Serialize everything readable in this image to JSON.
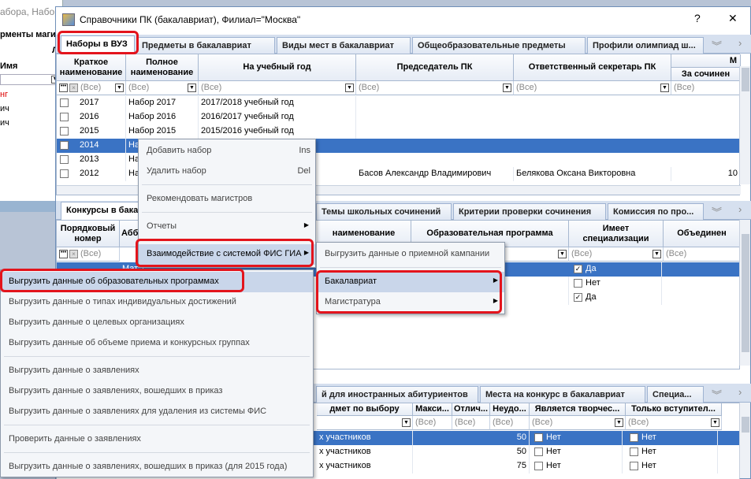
{
  "bg_window": {
    "title": "абора, Набор",
    "header": "рменты магис",
    "col_letter": "Л",
    "name_col": "Имя",
    "rows": [
      "нг",
      "ич",
      "ич"
    ]
  },
  "window": {
    "title": "Справочники ПК (бакалавриат), Филиал=\"Москва\"",
    "help": "?",
    "close": "✕"
  },
  "top_tabs": [
    "Наборы в ВУЗ",
    "Предметы в бакалавриат",
    "Виды мест в бакалавриат",
    "Общеобразовательные предметы",
    "Профили олимпиад ш..."
  ],
  "grid1": {
    "headers": [
      "Краткое наименование",
      "Полное наименование",
      "На учебный год",
      "Председатель ПК",
      "Ответственный секретарь ПК",
      "За сочинен"
    ],
    "group_header": "М",
    "filter_all": "(Все)",
    "rows": [
      {
        "short": "2017",
        "full": "Набор 2017",
        "year": "2017/2018 учебный год",
        "chair": "",
        "secretary": "",
        "extra": ""
      },
      {
        "short": "2016",
        "full": "Набор 2016",
        "year": "2016/2017 учебный год",
        "chair": "",
        "secretary": "",
        "extra": ""
      },
      {
        "short": "2015",
        "full": "Набор 2015",
        "year": "2015/2016 учебный год",
        "chair": "",
        "secretary": "",
        "extra": ""
      },
      {
        "short": "2014",
        "full": "На",
        "year": "",
        "chair": "",
        "secretary": "",
        "extra": ""
      },
      {
        "short": "2013",
        "full": "На",
        "year": "",
        "chair": "",
        "secretary": "",
        "extra": ""
      },
      {
        "short": "2012",
        "full": "На",
        "year": "",
        "chair": "Басов Александр Владимирович",
        "secretary": "Белякова Оксана Викторовна",
        "extra": "10"
      }
    ]
  },
  "mid_tabs": [
    "Конкурсы в бака",
    "Темы школьных сочинений",
    "Критерии проверки сочинения",
    "Комиссия по про..."
  ],
  "grid2": {
    "headers": [
      "Порядковый номер",
      "Абб",
      "наименование",
      "Образовательная программа",
      "Имеет специализации",
      "Объединен"
    ],
    "filter_all": "(Все)",
    "rows": [
      {
        "c1": "",
        "abbr": "Мат",
        "prog": "",
        "spec": "Да",
        "checked": true
      },
      {
        "c1": "",
        "abbr": "",
        "prog": "ность",
        "spec": "Нет",
        "checked": false
      },
      {
        "c1": "",
        "abbr": "",
        "prog": "ет)",
        "spec": "Да",
        "checked": true
      }
    ]
  },
  "bottom_tabs": [
    "й для иностранных абитуриентов",
    "Места на конкурс в бакалавриат",
    "Специа..."
  ],
  "grid3": {
    "headers": [
      "дмет по выбору",
      "Макси...",
      "Отлич...",
      "Неудо...",
      "Является творчес...",
      "Только вступител..."
    ],
    "filter_all": "(Все)",
    "rows": [
      {
        "subj": "х участников",
        "neud": "50",
        "creative": "Нет",
        "only": "Нет"
      },
      {
        "subj": "х участников",
        "neud": "50",
        "creative": "Нет",
        "only": "Нет"
      },
      {
        "subj": "х участников",
        "neud": "75",
        "creative": "Нет",
        "only": "Нет"
      }
    ]
  },
  "context_menu": {
    "items": [
      {
        "label": "Добавить набор",
        "shortcut": "Ins"
      },
      {
        "label": "Удалить набор",
        "shortcut": "Del"
      },
      {
        "label": "Рекомендовать магистров",
        "shortcut": ""
      },
      {
        "label": "Отчеты",
        "shortcut": ""
      },
      {
        "label": "Взаимодействие с системой ФИС ГИА",
        "shortcut": ""
      }
    ]
  },
  "submenu_fis": {
    "items": [
      "Выгрузить данные о приемной кампании",
      "Бакалавриат",
      "Магистратура"
    ]
  },
  "submenu_export": {
    "items": [
      "Выгрузить данные об образовательных программах",
      "Выгрузить данные о типах индивидуальных достижений",
      "Выгрузить данные о целевых организациях",
      "Выгрузить данные об объеме приема и конкурсных группах",
      "Выгрузить данные о заявлениях",
      "Выгрузить данные о заявлениях, вошедших в приказ",
      "Выгрузить данные о заявлениях для удаления из системы ФИС",
      "Проверить данные о заявлениях",
      "Выгрузить данные о заявлениях, вошедших в приказ (для 2015 года)"
    ]
  },
  "colors": {
    "highlight": "#e3141c",
    "selection": "#3a73c4",
    "tab_bg": "#d6e0ef"
  }
}
